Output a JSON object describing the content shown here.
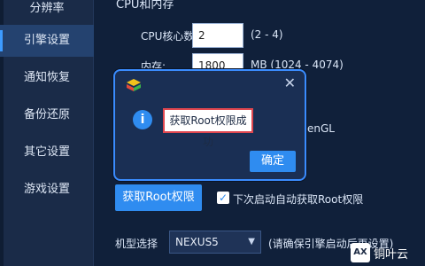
{
  "sidebar": {
    "items": [
      {
        "label": "分辨率"
      },
      {
        "label": "引擎设置"
      },
      {
        "label": "通知恢复"
      },
      {
        "label": "备份还原"
      },
      {
        "label": "其它设置"
      },
      {
        "label": "游戏设置"
      }
    ],
    "active_index": 1
  },
  "main": {
    "section_title": "CPU和内存",
    "cpu": {
      "label": "CPU核心数:",
      "value": "2",
      "range": "(2 - 4)"
    },
    "memory": {
      "label": "内存:",
      "value": "1800",
      "range": "MB  (1024 - 4074)"
    },
    "render_hint": "enGL",
    "root_button": "获取Root权限",
    "auto_root": {
      "label": "下次启动自动获取Root权限",
      "checked": true
    },
    "model": {
      "label": "机型选择",
      "value": "NEXUS5",
      "note": "(请确保引擎启动后再设置)"
    }
  },
  "modal": {
    "message": "获取Root权限成功",
    "ok_label": "确定",
    "close_symbol": "✕",
    "info_symbol": "i"
  },
  "watermark": {
    "logo_text": "AX",
    "text": "铜叶云"
  },
  "colors": {
    "accent": "#2f8cf0",
    "modal_border": "#3a8cff",
    "highlight_box": "#e0474f"
  }
}
